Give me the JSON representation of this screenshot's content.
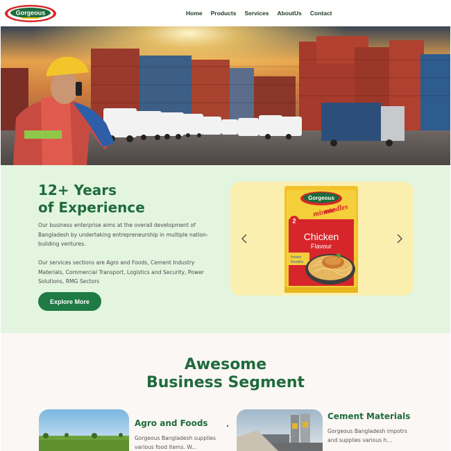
{
  "header": {
    "logo_text": "Gorgeous",
    "nav": [
      "Home",
      "Products",
      "Services",
      "AboutUs",
      "Contact"
    ]
  },
  "hero": {
    "image": "cargo-port-worker-photo"
  },
  "experience": {
    "title": "12+ Years\nof Experience",
    "paragraph1": "Our business enterprise aims at the overall development of Bangladesh by undertaking entrepreneurship in multiple nation-building ventures.",
    "paragraph2": "Our services sections are Agro and Foods, Cement Industry Materials, Commercial Transport, Logistics and Security, Power Solutions, RMG Sectors",
    "button": "Explore More",
    "carousel": {
      "prev_icon": "chevron-left-icon",
      "next_icon": "chevron-right-icon",
      "product": {
        "brand": "Gorgeous",
        "line1": "2",
        "line2": "minute",
        "line3": "noodles",
        "flavour1": "Chicken",
        "flavour2": "Flavour",
        "tag1": "Instant",
        "tag2": "Noodles"
      }
    }
  },
  "segments": {
    "title": "Awesome\nBusiness Segment",
    "cards": [
      {
        "title": "Agro and Foods",
        "desc": "Gorgeous Bangladesh supplies various food items. W..."
      },
      {
        "title": "Cement Materials",
        "desc": "Gorgeous Bangladesh impotrs and supplies various h..."
      }
    ]
  },
  "colors": {
    "brand_green": "#1f6b3c",
    "button_green": "#1f7a44",
    "mint_background": "#e3f5df",
    "carousel_background": "#fbefb0",
    "segment_background": "#fbf7f5"
  }
}
